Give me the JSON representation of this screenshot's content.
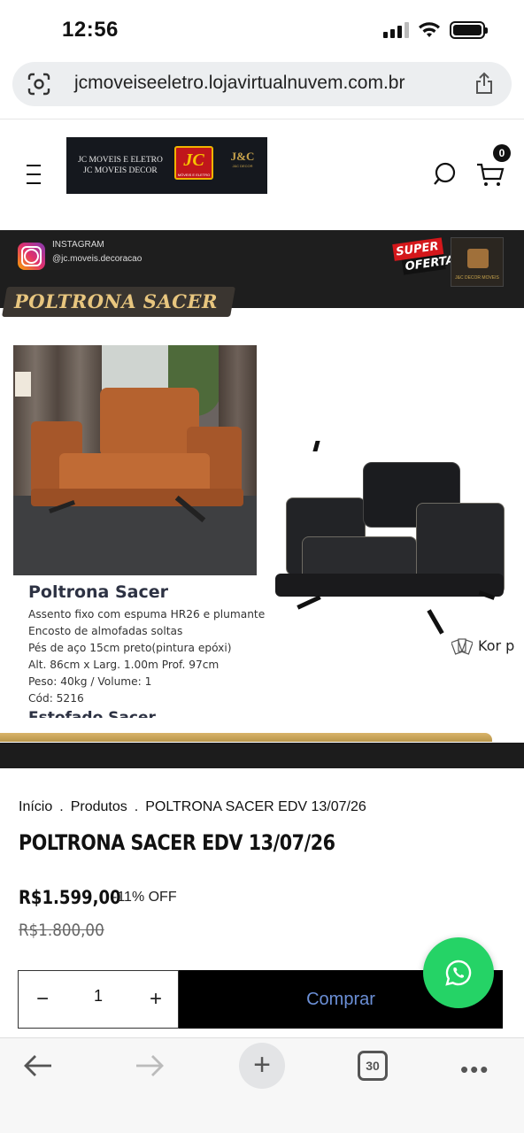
{
  "status": {
    "time": "12:56"
  },
  "browser": {
    "url": "jcmoveiseeletro.lojavirtualnuvem.com.br",
    "tab_count": "30"
  },
  "header": {
    "logo_line1": "JC MOVEIS E ELETRO",
    "logo_line2": "JC MOVEIS DECOR",
    "logo_jc": "JC",
    "logo_jc_sub": "MÓVEIS E ELETRO",
    "logo_jandc": "J&C",
    "logo_jandc_sub": "J&C DECOR",
    "cart_count": "0"
  },
  "banner": {
    "instagram_label": "INSTAGRAM",
    "instagram_handle": "@jc.moveis.decoracao",
    "super": "SUPER",
    "oferta": "OFERTA",
    "decor_label": "J&C DECOR MOVEIS",
    "title": "POLTRONA SACER",
    "spec_title": "Poltrona Sacer",
    "spec_lines": [
      "Assento fixo com espuma HR26 e plumante",
      "Encosto de almofadas soltas",
      "Pés de aço 15cm preto(pintura epóxi)",
      "Alt. 86cm x Larg. 1.00m Prof. 97cm",
      "Peso: 40kg / Volume: 1",
      "Cód: 5216"
    ],
    "spec_cut": "Estofado Sacer",
    "kor_label": "Kor p"
  },
  "breadcrumb": {
    "home": "Início",
    "products": "Produtos",
    "current": "POLTRONA SACER EDV 13/07/26",
    "sep": "."
  },
  "product": {
    "title": "POLTRONA SACER EDV 13/07/26",
    "price": "R$1.599,00",
    "discount": "-11% OFF",
    "old_price": "R$1.800,00",
    "quantity": "1",
    "buy_label": "Comprar"
  },
  "colors": {
    "accent": "#25d366",
    "buy_text": "#6b8fd6",
    "gold": "#e8c67f"
  }
}
